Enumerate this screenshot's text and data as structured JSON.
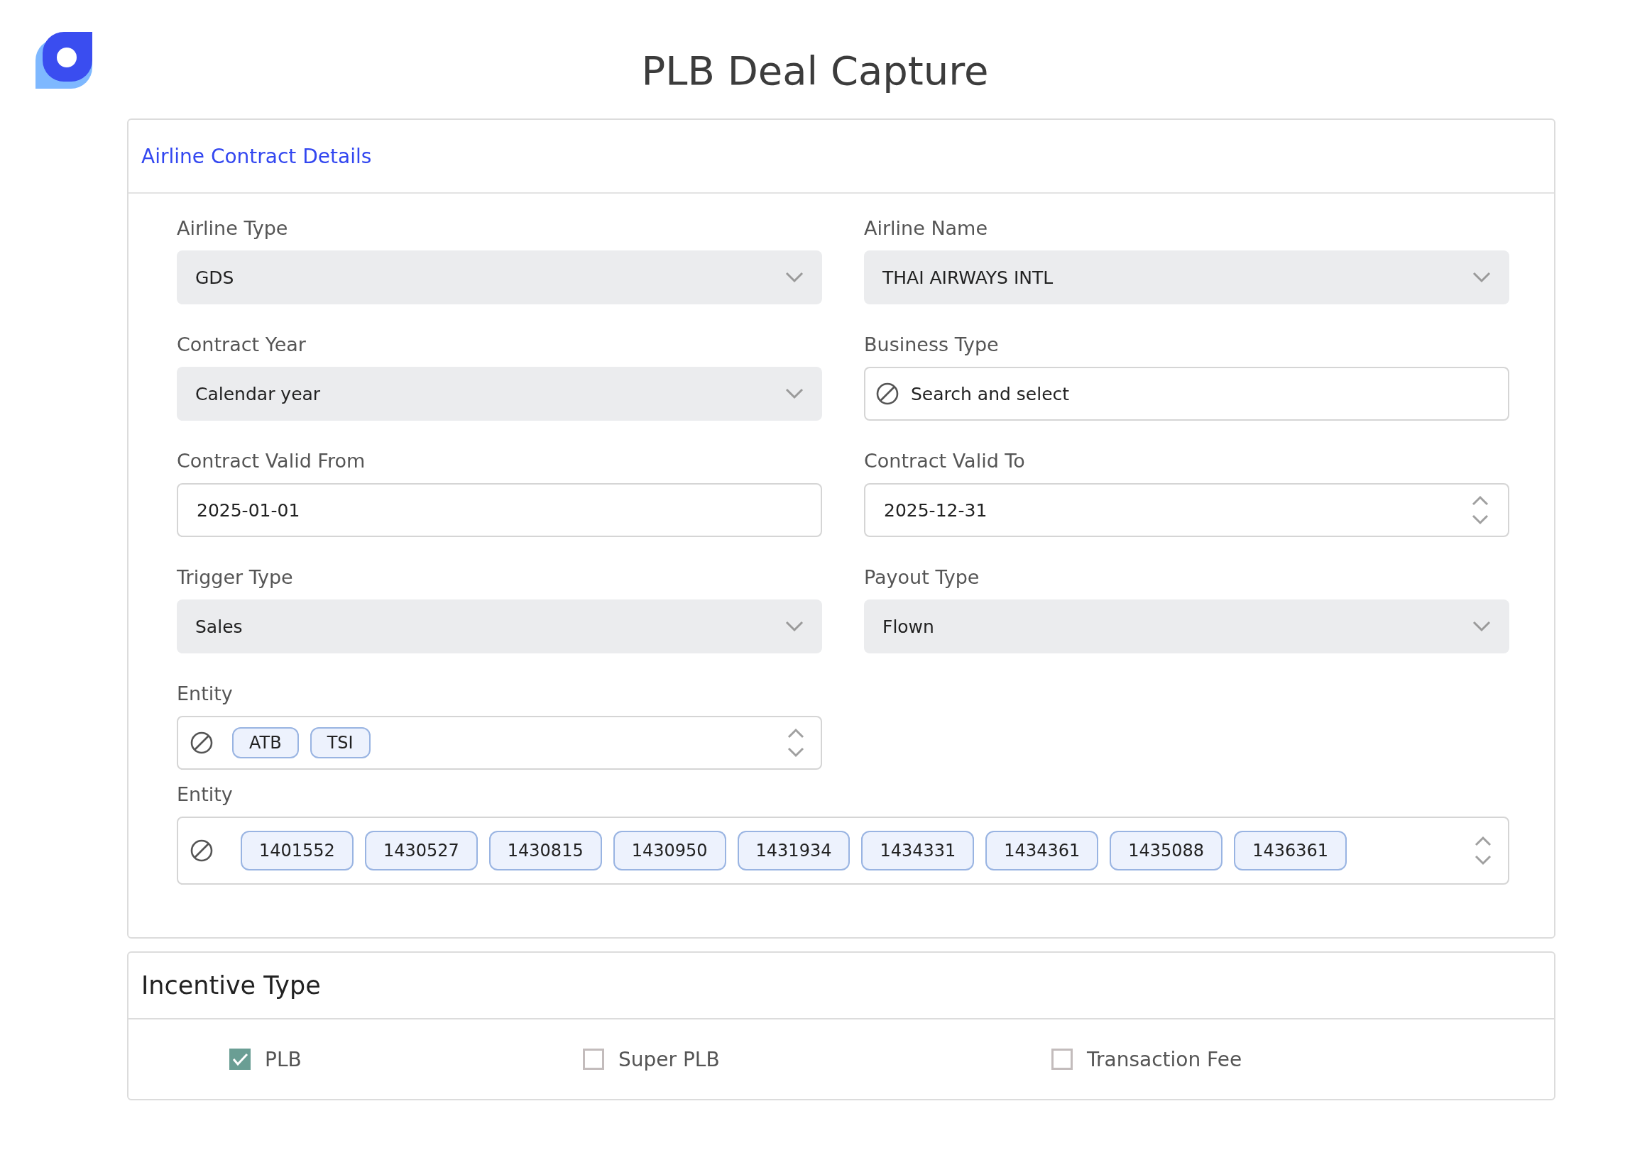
{
  "header": {
    "title": "PLB Deal Capture"
  },
  "contract": {
    "heading": "Airline Contract Details",
    "fields": [
      {
        "kind": "select",
        "label": "Airline Type",
        "value": "GDS"
      },
      {
        "kind": "select",
        "label": "Airline Name",
        "value": "THAI AIRWAYS INTL"
      },
      {
        "kind": "select",
        "label": "Contract Year",
        "value": "Calendar year"
      },
      {
        "kind": "search",
        "label": "Business Type",
        "placeholder": "Search and select"
      },
      {
        "kind": "text",
        "label": "Contract Valid From",
        "value": "2025-01-01"
      },
      {
        "kind": "spinner",
        "label": "Contract Valid To",
        "value": "2025-12-31"
      },
      {
        "kind": "select",
        "label": "Trigger Type",
        "value": "Sales"
      },
      {
        "kind": "select",
        "label": "Payout Type",
        "value": "Flown"
      },
      {
        "kind": "chips",
        "label": "Entity",
        "chips": [
          "ATB",
          "TSI"
        ]
      },
      {
        "kind": "chips_wide",
        "label": "Entity",
        "chips": [
          "1401552",
          "1430527",
          "1430815",
          "1430950",
          "1431934",
          "1434331",
          "1434361",
          "1435088",
          "1436361"
        ]
      }
    ]
  },
  "incentive": {
    "heading": "Incentive Type",
    "options": [
      {
        "label": "PLB",
        "checked": true
      },
      {
        "label": "Super PLB",
        "checked": false
      },
      {
        "label": "Transaction Fee",
        "checked": false
      }
    ]
  }
}
